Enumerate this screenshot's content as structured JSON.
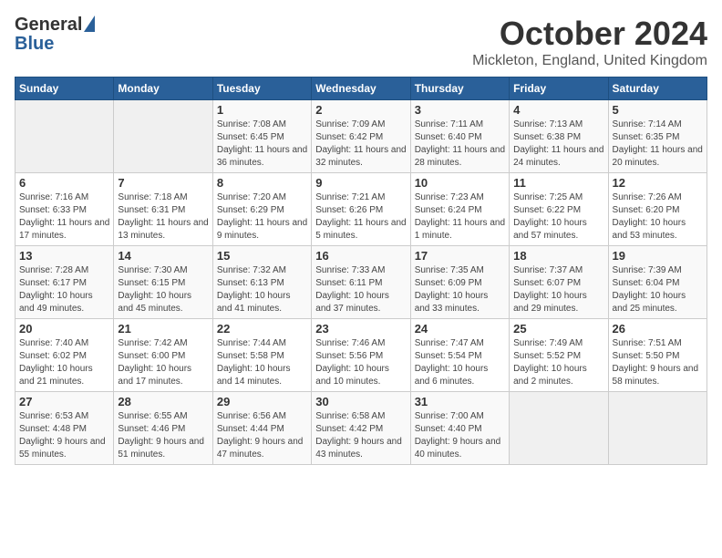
{
  "header": {
    "logo_general": "General",
    "logo_blue": "Blue",
    "month": "October 2024",
    "location": "Mickleton, England, United Kingdom"
  },
  "days_of_week": [
    "Sunday",
    "Monday",
    "Tuesday",
    "Wednesday",
    "Thursday",
    "Friday",
    "Saturday"
  ],
  "weeks": [
    [
      {
        "day": "",
        "sunrise": "",
        "sunset": "",
        "daylight": ""
      },
      {
        "day": "",
        "sunrise": "",
        "sunset": "",
        "daylight": ""
      },
      {
        "day": "1",
        "sunrise": "Sunrise: 7:08 AM",
        "sunset": "Sunset: 6:45 PM",
        "daylight": "Daylight: 11 hours and 36 minutes."
      },
      {
        "day": "2",
        "sunrise": "Sunrise: 7:09 AM",
        "sunset": "Sunset: 6:42 PM",
        "daylight": "Daylight: 11 hours and 32 minutes."
      },
      {
        "day": "3",
        "sunrise": "Sunrise: 7:11 AM",
        "sunset": "Sunset: 6:40 PM",
        "daylight": "Daylight: 11 hours and 28 minutes."
      },
      {
        "day": "4",
        "sunrise": "Sunrise: 7:13 AM",
        "sunset": "Sunset: 6:38 PM",
        "daylight": "Daylight: 11 hours and 24 minutes."
      },
      {
        "day": "5",
        "sunrise": "Sunrise: 7:14 AM",
        "sunset": "Sunset: 6:35 PM",
        "daylight": "Daylight: 11 hours and 20 minutes."
      }
    ],
    [
      {
        "day": "6",
        "sunrise": "Sunrise: 7:16 AM",
        "sunset": "Sunset: 6:33 PM",
        "daylight": "Daylight: 11 hours and 17 minutes."
      },
      {
        "day": "7",
        "sunrise": "Sunrise: 7:18 AM",
        "sunset": "Sunset: 6:31 PM",
        "daylight": "Daylight: 11 hours and 13 minutes."
      },
      {
        "day": "8",
        "sunrise": "Sunrise: 7:20 AM",
        "sunset": "Sunset: 6:29 PM",
        "daylight": "Daylight: 11 hours and 9 minutes."
      },
      {
        "day": "9",
        "sunrise": "Sunrise: 7:21 AM",
        "sunset": "Sunset: 6:26 PM",
        "daylight": "Daylight: 11 hours and 5 minutes."
      },
      {
        "day": "10",
        "sunrise": "Sunrise: 7:23 AM",
        "sunset": "Sunset: 6:24 PM",
        "daylight": "Daylight: 11 hours and 1 minute."
      },
      {
        "day": "11",
        "sunrise": "Sunrise: 7:25 AM",
        "sunset": "Sunset: 6:22 PM",
        "daylight": "Daylight: 10 hours and 57 minutes."
      },
      {
        "day": "12",
        "sunrise": "Sunrise: 7:26 AM",
        "sunset": "Sunset: 6:20 PM",
        "daylight": "Daylight: 10 hours and 53 minutes."
      }
    ],
    [
      {
        "day": "13",
        "sunrise": "Sunrise: 7:28 AM",
        "sunset": "Sunset: 6:17 PM",
        "daylight": "Daylight: 10 hours and 49 minutes."
      },
      {
        "day": "14",
        "sunrise": "Sunrise: 7:30 AM",
        "sunset": "Sunset: 6:15 PM",
        "daylight": "Daylight: 10 hours and 45 minutes."
      },
      {
        "day": "15",
        "sunrise": "Sunrise: 7:32 AM",
        "sunset": "Sunset: 6:13 PM",
        "daylight": "Daylight: 10 hours and 41 minutes."
      },
      {
        "day": "16",
        "sunrise": "Sunrise: 7:33 AM",
        "sunset": "Sunset: 6:11 PM",
        "daylight": "Daylight: 10 hours and 37 minutes."
      },
      {
        "day": "17",
        "sunrise": "Sunrise: 7:35 AM",
        "sunset": "Sunset: 6:09 PM",
        "daylight": "Daylight: 10 hours and 33 minutes."
      },
      {
        "day": "18",
        "sunrise": "Sunrise: 7:37 AM",
        "sunset": "Sunset: 6:07 PM",
        "daylight": "Daylight: 10 hours and 29 minutes."
      },
      {
        "day": "19",
        "sunrise": "Sunrise: 7:39 AM",
        "sunset": "Sunset: 6:04 PM",
        "daylight": "Daylight: 10 hours and 25 minutes."
      }
    ],
    [
      {
        "day": "20",
        "sunrise": "Sunrise: 7:40 AM",
        "sunset": "Sunset: 6:02 PM",
        "daylight": "Daylight: 10 hours and 21 minutes."
      },
      {
        "day": "21",
        "sunrise": "Sunrise: 7:42 AM",
        "sunset": "Sunset: 6:00 PM",
        "daylight": "Daylight: 10 hours and 17 minutes."
      },
      {
        "day": "22",
        "sunrise": "Sunrise: 7:44 AM",
        "sunset": "Sunset: 5:58 PM",
        "daylight": "Daylight: 10 hours and 14 minutes."
      },
      {
        "day": "23",
        "sunrise": "Sunrise: 7:46 AM",
        "sunset": "Sunset: 5:56 PM",
        "daylight": "Daylight: 10 hours and 10 minutes."
      },
      {
        "day": "24",
        "sunrise": "Sunrise: 7:47 AM",
        "sunset": "Sunset: 5:54 PM",
        "daylight": "Daylight: 10 hours and 6 minutes."
      },
      {
        "day": "25",
        "sunrise": "Sunrise: 7:49 AM",
        "sunset": "Sunset: 5:52 PM",
        "daylight": "Daylight: 10 hours and 2 minutes."
      },
      {
        "day": "26",
        "sunrise": "Sunrise: 7:51 AM",
        "sunset": "Sunset: 5:50 PM",
        "daylight": "Daylight: 9 hours and 58 minutes."
      }
    ],
    [
      {
        "day": "27",
        "sunrise": "Sunrise: 6:53 AM",
        "sunset": "Sunset: 4:48 PM",
        "daylight": "Daylight: 9 hours and 55 minutes."
      },
      {
        "day": "28",
        "sunrise": "Sunrise: 6:55 AM",
        "sunset": "Sunset: 4:46 PM",
        "daylight": "Daylight: 9 hours and 51 minutes."
      },
      {
        "day": "29",
        "sunrise": "Sunrise: 6:56 AM",
        "sunset": "Sunset: 4:44 PM",
        "daylight": "Daylight: 9 hours and 47 minutes."
      },
      {
        "day": "30",
        "sunrise": "Sunrise: 6:58 AM",
        "sunset": "Sunset: 4:42 PM",
        "daylight": "Daylight: 9 hours and 43 minutes."
      },
      {
        "day": "31",
        "sunrise": "Sunrise: 7:00 AM",
        "sunset": "Sunset: 4:40 PM",
        "daylight": "Daylight: 9 hours and 40 minutes."
      },
      {
        "day": "",
        "sunrise": "",
        "sunset": "",
        "daylight": ""
      },
      {
        "day": "",
        "sunrise": "",
        "sunset": "",
        "daylight": ""
      }
    ]
  ]
}
